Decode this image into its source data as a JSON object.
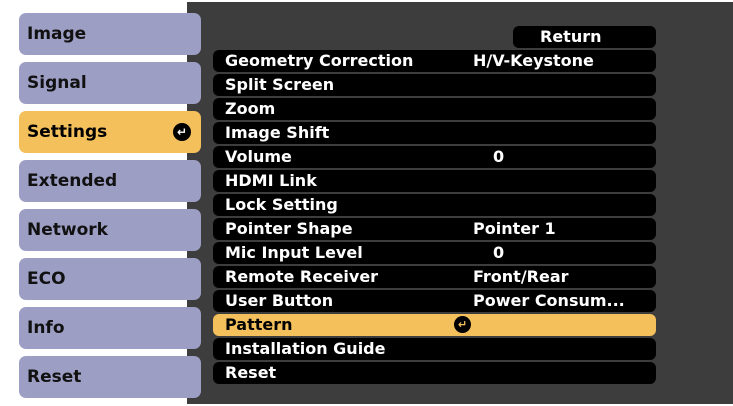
{
  "tabs": [
    {
      "label": "Image"
    },
    {
      "label": "Signal"
    },
    {
      "label": "Settings",
      "active": true
    },
    {
      "label": "Extended"
    },
    {
      "label": "Network"
    },
    {
      "label": "ECO"
    },
    {
      "label": "Info"
    },
    {
      "label": "Reset"
    }
  ],
  "return_label": "Return",
  "menu": [
    {
      "label": "Geometry Correction",
      "value": "H/V-Keystone"
    },
    {
      "label": "Split Screen",
      "value": ""
    },
    {
      "label": "Zoom",
      "value": ""
    },
    {
      "label": "Image Shift",
      "value": ""
    },
    {
      "label": "Volume",
      "value": "0"
    },
    {
      "label": "HDMI Link",
      "value": ""
    },
    {
      "label": "Lock Setting",
      "value": ""
    },
    {
      "label": "Pointer Shape",
      "value": "Pointer 1"
    },
    {
      "label": "Mic Input Level",
      "value": "0"
    },
    {
      "label": "Remote Receiver",
      "value": "Front/Rear"
    },
    {
      "label": "User Button",
      "value": "Power Consum..."
    },
    {
      "label": "Pattern",
      "value": "",
      "selected": true
    },
    {
      "label": "Installation Guide",
      "value": ""
    },
    {
      "label": "Reset",
      "value": ""
    }
  ],
  "colors": {
    "tab": "#9d9ec4",
    "highlight": "#f4c05c",
    "panel": "#3d3d3d",
    "row": "#000000"
  },
  "icons": {
    "enter": "enter-icon"
  }
}
